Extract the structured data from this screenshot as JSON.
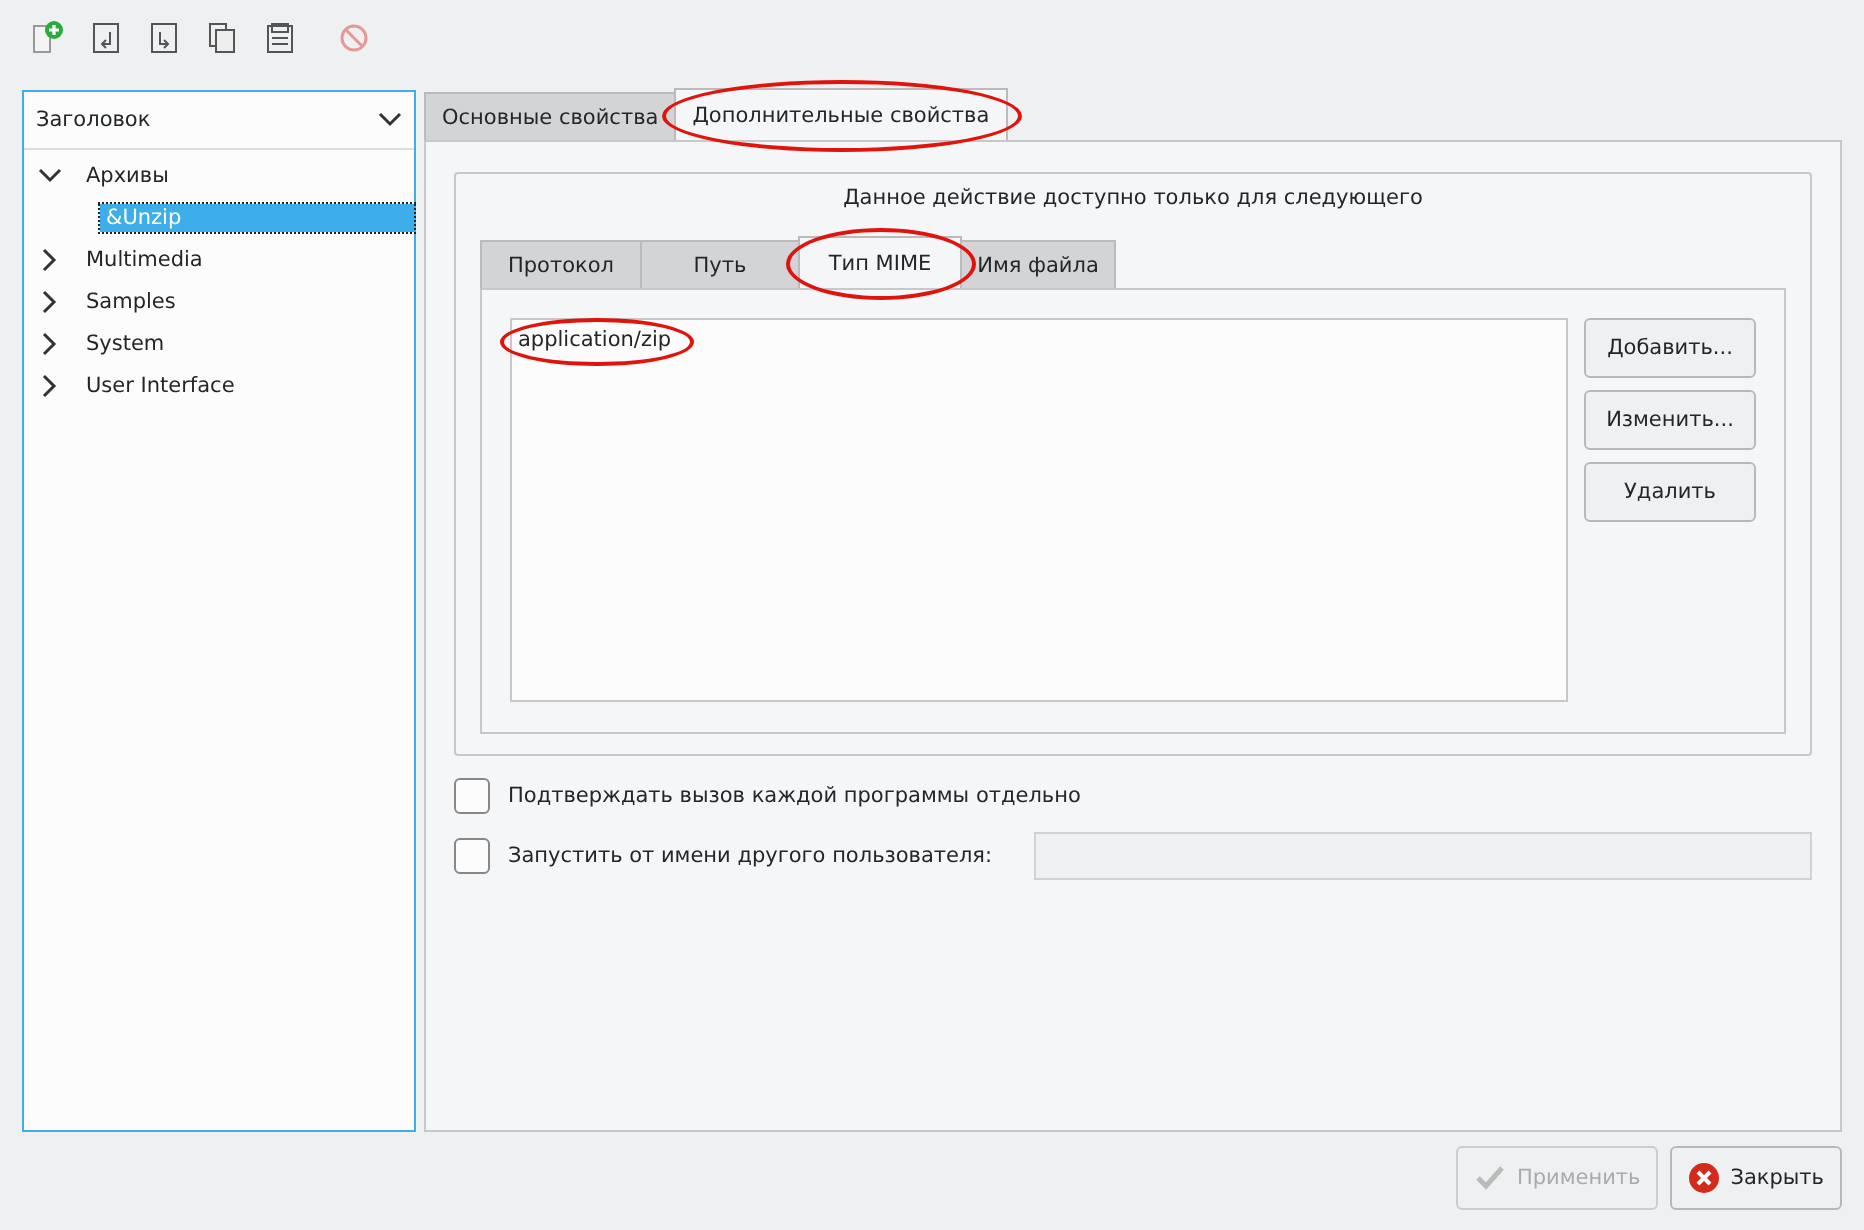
{
  "toolbar": [
    {
      "kind": "new",
      "disabled": false
    },
    {
      "kind": "import",
      "disabled": false
    },
    {
      "kind": "export",
      "disabled": false
    },
    {
      "kind": "copy",
      "disabled": false
    },
    {
      "kind": "paste",
      "disabled": false
    },
    {
      "kind": "delete",
      "disabled": true
    }
  ],
  "tree": {
    "header": "Заголовок",
    "items": [
      {
        "label": "Архивы",
        "expanded": true,
        "selected": false,
        "children": [
          {
            "label": "&Unzip",
            "selected": true
          }
        ]
      },
      {
        "label": "Multimedia",
        "expanded": false,
        "selected": false
      },
      {
        "label": "Samples",
        "expanded": false,
        "selected": false
      },
      {
        "label": "System",
        "expanded": false,
        "selected": false
      },
      {
        "label": "User Interface",
        "expanded": false,
        "selected": false
      }
    ]
  },
  "tabs": [
    {
      "label": "Основные свойства",
      "selected": false,
      "circled": false
    },
    {
      "label": "Дополнительные свойства",
      "selected": true,
      "circled": true
    }
  ],
  "group": {
    "title": "Данное действие доступно только для следующего",
    "tabs": [
      {
        "label": "Протокол",
        "selected": false,
        "circled": false
      },
      {
        "label": "Путь",
        "selected": false,
        "circled": false
      },
      {
        "label": "Тип MIME",
        "selected": true,
        "circled": true
      },
      {
        "label": "Имя файла",
        "selected": false,
        "circled": false
      }
    ],
    "list": [
      {
        "label": "application/zip",
        "circled": true
      }
    ],
    "buttons": [
      {
        "label": "Добавить...",
        "disabled": false
      },
      {
        "label": "Изменить...",
        "disabled": false
      },
      {
        "label": "Удалить",
        "disabled": false
      }
    ]
  },
  "options": [
    {
      "label": "Подтверждать вызов каждой программы отдельно",
      "checked": false
    },
    {
      "label": "Запустить от имени другого пользователя:",
      "checked": false,
      "field": {
        "disabled": true
      }
    }
  ],
  "footer": [
    {
      "label": "Применить",
      "kind": "apply",
      "disabled": true
    },
    {
      "label": "Закрыть",
      "kind": "close",
      "disabled": false
    }
  ]
}
